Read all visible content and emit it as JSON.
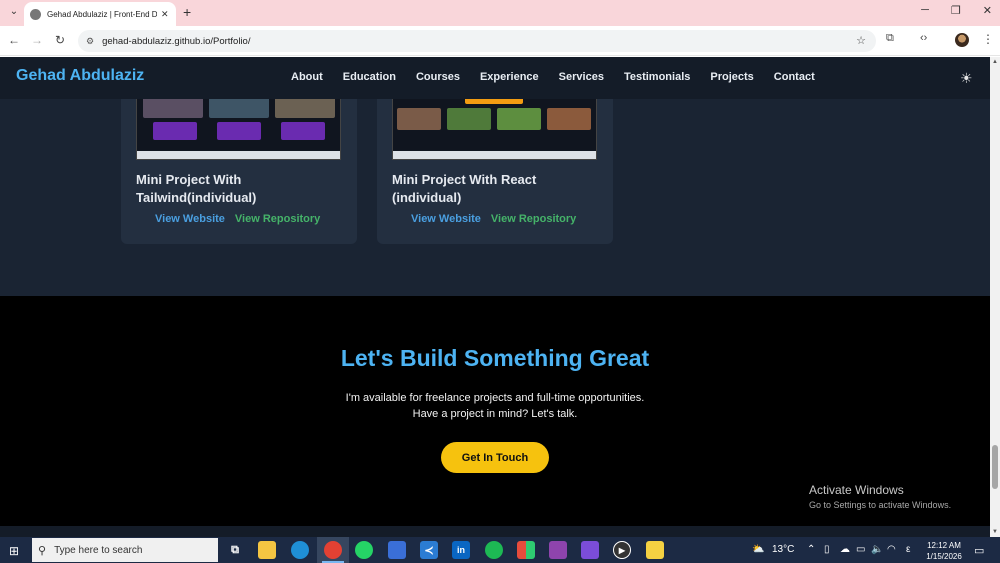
{
  "browser": {
    "tab_title": "Gehad Abdulaziz | Front-End D",
    "url": "gehad-abdulaziz.github.io/Portfolio/"
  },
  "site": {
    "brand": "Gehad Abdulaziz",
    "nav": [
      "About",
      "Education",
      "Courses",
      "Experience",
      "Services",
      "Testimonials",
      "Projects",
      "Contact"
    ],
    "theme_icon": "sun-icon"
  },
  "projects": [
    {
      "title": "Mini Project With Tailwind(individual)",
      "site_link": "View Website",
      "repo_link": "View Repository"
    },
    {
      "title": "Mini Project With React (individual)",
      "site_link": "View Website",
      "repo_link": "View Repository"
    }
  ],
  "cta": {
    "title": "Let's Build Something Great",
    "line1": "I'm available for freelance projects and full-time opportunities.",
    "line2": "Have a project in mind? Let's talk.",
    "button": "Get In Touch"
  },
  "watermark": {
    "title": "Activate Windows",
    "subtitle": "Go to Settings to activate Windows."
  },
  "taskbar": {
    "search_placeholder": "Type here to search",
    "temperature": "13°C",
    "time": "12:12 AM",
    "date": "1/15/2026",
    "language": "ε"
  },
  "colors": {
    "accent": "#4db3f2",
    "link_site": "#4a9fe0",
    "link_repo": "#45b369",
    "button": "#f6c20e",
    "header_bg": "#141c28",
    "section_bg": "#1a2433"
  }
}
